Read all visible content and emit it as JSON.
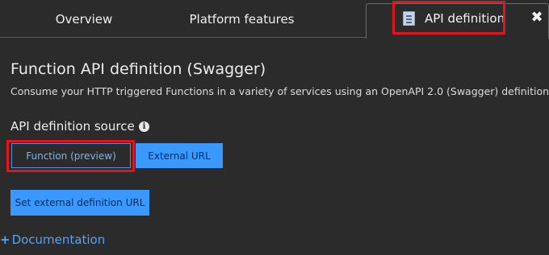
{
  "tabs": {
    "overview": "Overview",
    "platform_features": "Platform features",
    "api_definition": "API definition",
    "close_glyph": "✖"
  },
  "main": {
    "title": "Function API definition (Swagger)",
    "description": "Consume your HTTP triggered Functions in a variety of services using an OpenAPI 2.0 (Swagger) definition",
    "source_label": "API definition source",
    "info_glyph": "i",
    "source_options": {
      "function": "Function (preview)",
      "external": "External URL"
    },
    "set_url_button": "Set external definition URL",
    "documentation": {
      "plus": "+",
      "label": "Documentation"
    }
  },
  "colors": {
    "background": "#2b2b2b",
    "accent": "#3999ff",
    "highlight": "#e0141e",
    "link": "#5aa2f0"
  },
  "icons": [
    "document-icon",
    "close-icon",
    "info-icon",
    "plus-icon"
  ]
}
